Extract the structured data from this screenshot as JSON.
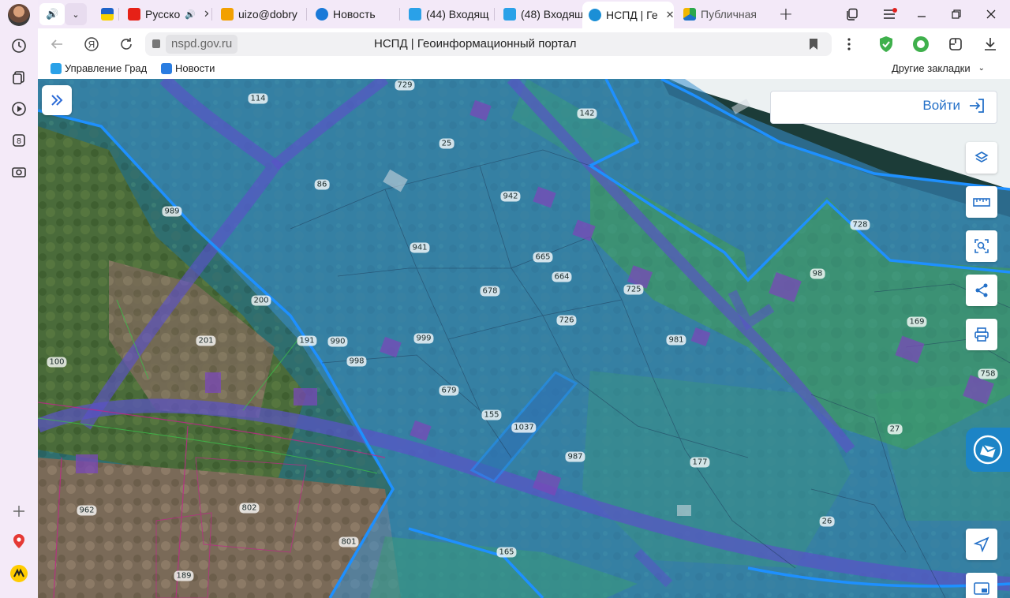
{
  "browser": {
    "tabs": [
      {
        "label": "",
        "kind": "audio"
      },
      {
        "label": "",
        "kind": "chevron"
      },
      {
        "label": "",
        "kind": "ukraine"
      },
      {
        "label": "Русско",
        "kind": "youtube"
      },
      {
        "label": "uizo@dobry",
        "kind": "mail"
      },
      {
        "label": "Новость",
        "kind": "at"
      },
      {
        "label": "(44) Входящ",
        "kind": "mailbox"
      },
      {
        "label": "(48) Входящ",
        "kind": "mailbox"
      },
      {
        "label": "НСПД | Ге",
        "kind": "nspd"
      },
      {
        "label": "Публичная",
        "kind": "pkk"
      }
    ],
    "new_tab": "+",
    "address": {
      "domain": "nspd.gov.ru",
      "title": "НСПД | Геоинформационный портал"
    },
    "bookmarks": [
      {
        "label": "Управление Град"
      },
      {
        "label": "Новости"
      }
    ],
    "other_bookmarks": "Другие закладки"
  },
  "map": {
    "login_label": "Войти",
    "parcel_labels": [
      {
        "text": "729"
      },
      {
        "text": "114"
      },
      {
        "text": "25"
      },
      {
        "text": "142"
      },
      {
        "text": "86"
      },
      {
        "text": "942"
      },
      {
        "text": "989"
      },
      {
        "text": "941"
      },
      {
        "text": "665"
      },
      {
        "text": "664"
      },
      {
        "text": "728"
      },
      {
        "text": "98"
      },
      {
        "text": "678"
      },
      {
        "text": "725"
      },
      {
        "text": "200"
      },
      {
        "text": "726"
      },
      {
        "text": "169"
      },
      {
        "text": "191"
      },
      {
        "text": "990"
      },
      {
        "text": "999"
      },
      {
        "text": "981"
      },
      {
        "text": "201"
      },
      {
        "text": "998"
      },
      {
        "text": "100"
      },
      {
        "text": "679"
      },
      {
        "text": "758"
      },
      {
        "text": "155"
      },
      {
        "text": "1037"
      },
      {
        "text": "27"
      },
      {
        "text": "987"
      },
      {
        "text": "177"
      },
      {
        "text": "962"
      },
      {
        "text": "802"
      },
      {
        "text": "26"
      },
      {
        "text": "801"
      },
      {
        "text": "165"
      },
      {
        "text": "189"
      }
    ],
    "colors": {
      "zone_blue": "#3a8fd0",
      "zone_border": "#1e90ff",
      "road_band": "#5a52c8",
      "green_zone": "#3ea06e",
      "accent": "#2470c8"
    }
  }
}
